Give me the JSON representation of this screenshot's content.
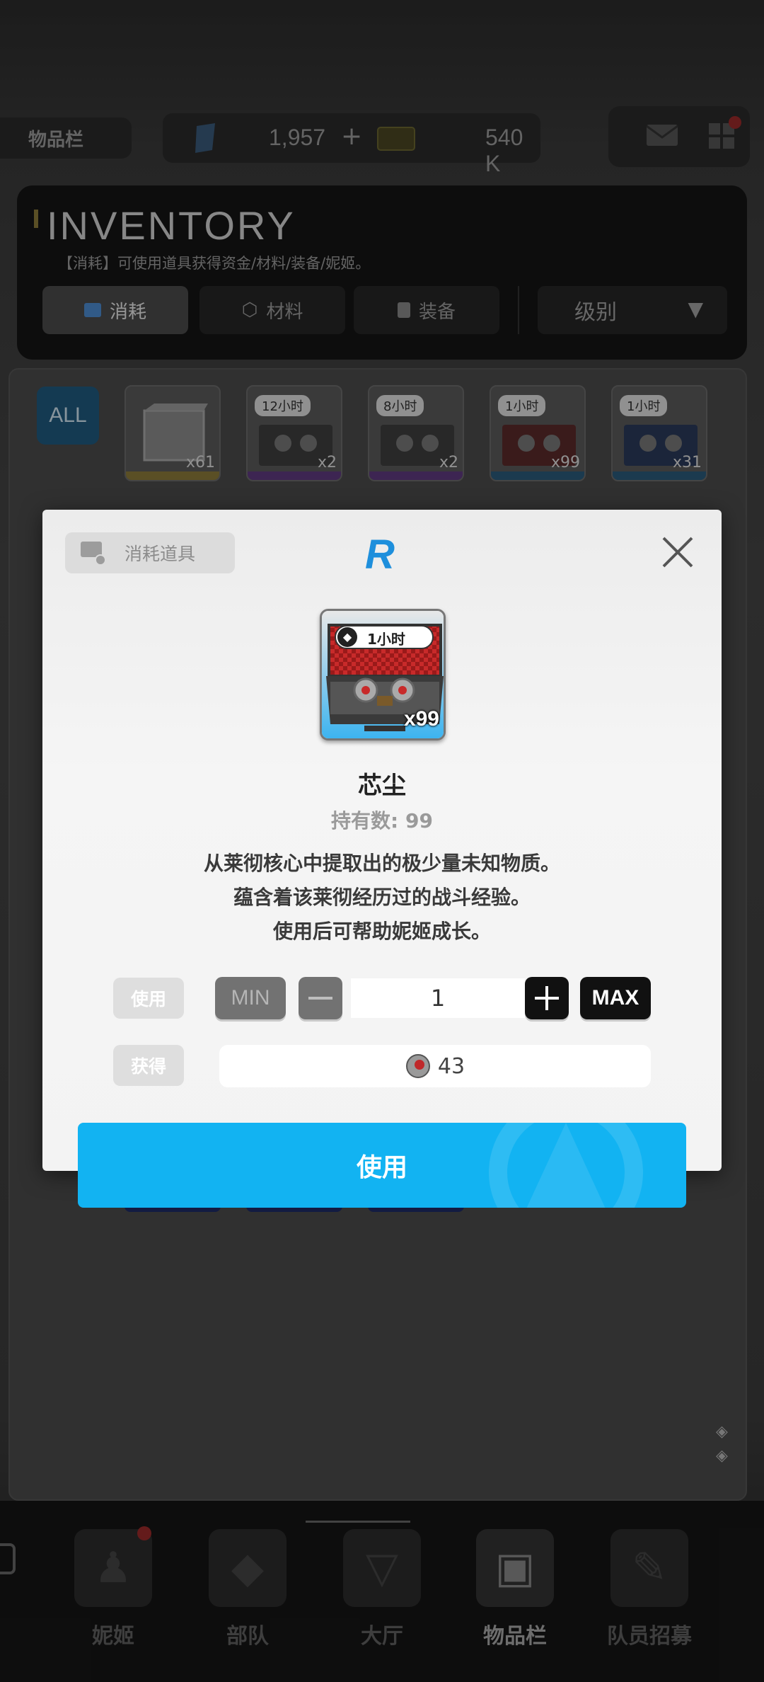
{
  "header": {
    "location_label": "物品栏",
    "gems": "1,957",
    "gems_plus": "+",
    "credits": "540 K"
  },
  "inventory": {
    "title": "INVENTORY",
    "subtitle": "【消耗】可使用道具获得资金/材料/装备/妮姬。",
    "tabs": [
      {
        "label": "消耗",
        "icon": "consumable-icon"
      },
      {
        "label": "材料",
        "icon": "material-icon"
      },
      {
        "label": "装备",
        "icon": "equipment-icon"
      }
    ],
    "sort_label": "级别",
    "all_label": "ALL",
    "items": [
      {
        "time": "",
        "qty": "x61",
        "rarity_color": "#c9a33a"
      },
      {
        "time": "12小时",
        "qty": "x2",
        "rarity_color": "#8a4cc9"
      },
      {
        "time": "8小时",
        "qty": "x2",
        "rarity_color": "#8a4cc9"
      },
      {
        "time": "1小时",
        "qty": "x99",
        "rarity_color": "#2f8fd6"
      },
      {
        "time": "1小时",
        "qty": "x31",
        "rarity_color": "#2f8fd6"
      }
    ]
  },
  "nav": [
    {
      "label": "妮姬",
      "icon": "nikke-icon"
    },
    {
      "label": "部队",
      "icon": "squad-icon"
    },
    {
      "label": "大厅",
      "icon": "lobby-icon"
    },
    {
      "label": "物品栏",
      "icon": "inventory-icon"
    },
    {
      "label": "队员招募",
      "icon": "recruit-icon"
    }
  ],
  "modal": {
    "category": "消耗道具",
    "rarity": "R",
    "item_time": "1小时",
    "item_qty": "x99",
    "name": "芯尘",
    "owned": "持有数: 99",
    "desc": [
      "从莱彻核心中提取出的极少量未知物质。",
      "蕴含着该莱彻经历过的战斗经验。",
      "使用后可帮助妮姬成长。"
    ],
    "use_label": "使用",
    "get_label": "获得",
    "min_label": "MIN",
    "max_label": "MAX",
    "quantity": "1",
    "reward_amount": "43",
    "confirm_label": "使用"
  },
  "colors": {
    "accent": "#12b3f2",
    "rarity_r": "#1e8fdc"
  }
}
